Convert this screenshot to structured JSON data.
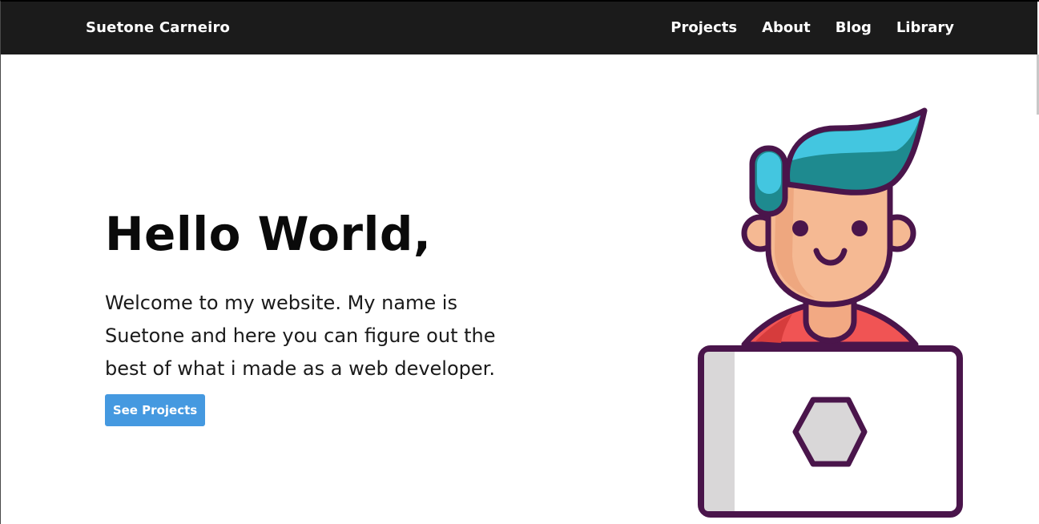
{
  "navbar": {
    "brand": "Suetone Carneiro",
    "links": [
      {
        "label": "Projects"
      },
      {
        "label": "About"
      },
      {
        "label": "Blog"
      },
      {
        "label": "Library"
      }
    ]
  },
  "hero": {
    "title": "Hello World,",
    "text": "Welcome to my website. My name is Suetone and here you can figure out the best of what i made as a web developer.",
    "button_label": "See Projects"
  },
  "illustration": {
    "icon": "developer-with-laptop-illustration"
  },
  "colors": {
    "navbar_bg": "#1b1b1b",
    "button_bg": "#4599e0",
    "outline": "#4a154b",
    "hair_dark": "#1e8a8f",
    "hair_light": "#43c6e0",
    "skin": "#f5b993",
    "shirt": "#f05454",
    "laptop_side": "#d9d7d8"
  }
}
